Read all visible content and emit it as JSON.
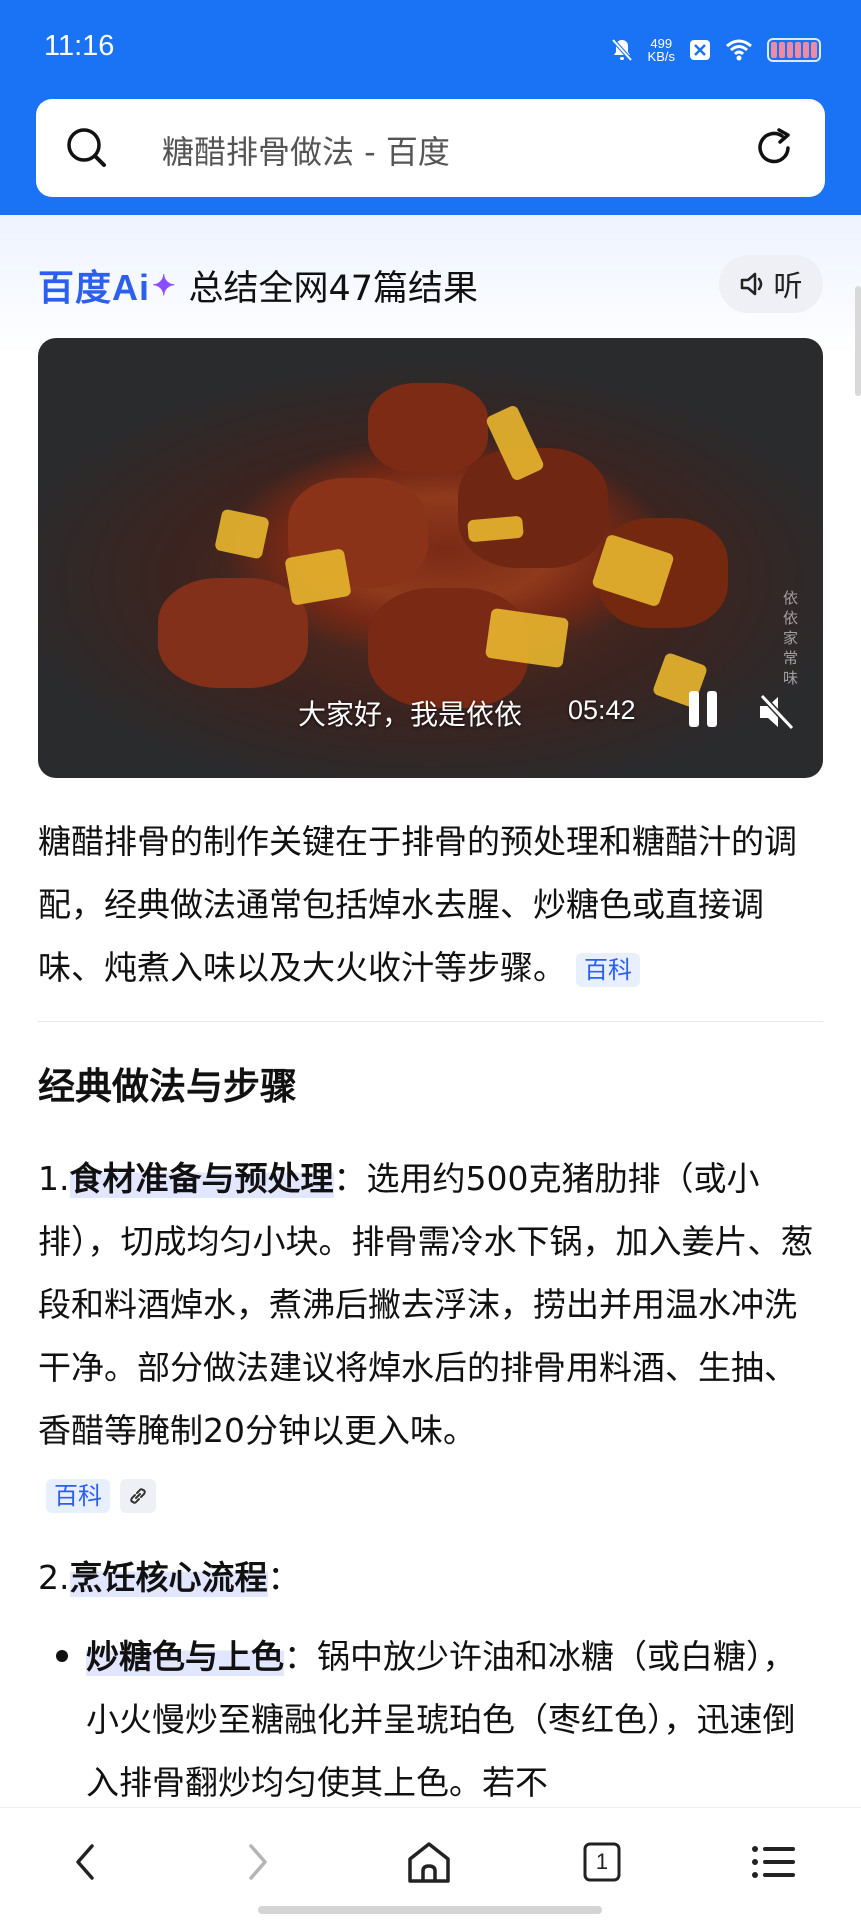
{
  "status_bar": {
    "time": "11:16",
    "net_speed_value": "499",
    "net_speed_unit": "KB/s"
  },
  "search": {
    "query": "糖醋排骨做法 - 百度"
  },
  "ai": {
    "brand": "百度Ai",
    "summary": "总结全网47篇结果",
    "listen_label": "听"
  },
  "video": {
    "caption": "大家好，我是依依",
    "duration": "05:42",
    "watermark": "依依家常味"
  },
  "intro": {
    "text": "糖醋排骨的制作关键在于排骨的预处理和糖醋汁的调配，经典做法通常包括焯水去腥、炒糖色或直接调味、炖煮入味以及大火收汁等步骤。",
    "tag": "百科"
  },
  "section": {
    "title": "经典做法与步骤",
    "step1": {
      "num": "1.",
      "label": "食材准备与预处理",
      "text": "：选用约500克猪肋排（或小排），切成均匀小块。排骨需冷水下锅，加入姜片、葱段和料酒焯水，煮沸后撇去浮沫，捞出并用温水冲洗干净。部分做法建议将焯水后的排骨用料酒、生抽、香醋等腌制20分钟以更入味。",
      "tag": "百科"
    },
    "step2": {
      "num": "2.",
      "label": "烹饪核心流程",
      "suffix": "："
    },
    "bullet1": {
      "label": "炒糖色与上色",
      "text": "：锅中放少许油和冰糖（或白糖），小火慢炒至糖融化并呈琥珀色（枣红色），迅速倒入排骨翻炒均匀使其上色。若不"
    }
  },
  "nav": {
    "tab_count": "1"
  },
  "colors": {
    "brand_blue": "#1a73f5",
    "ai_blue": "#2b5ff0",
    "tag_bg": "#e8efff"
  }
}
